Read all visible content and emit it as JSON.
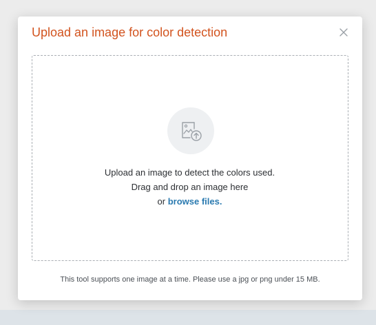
{
  "dialog": {
    "title": "Upload an image for color detection",
    "close_icon": "close-icon",
    "title_color": "#d2531e"
  },
  "dropzone": {
    "upload_icon": "image-upload-icon",
    "line1": "Upload an image to detect the colors used.",
    "line2": "Drag and drop an image here",
    "line3_prefix": "or ",
    "browse_link": "browse files.",
    "link_color": "#2a7ab0"
  },
  "footer": {
    "note": "This tool supports one image at a time. Please use a jpg or png under 15 MB."
  }
}
